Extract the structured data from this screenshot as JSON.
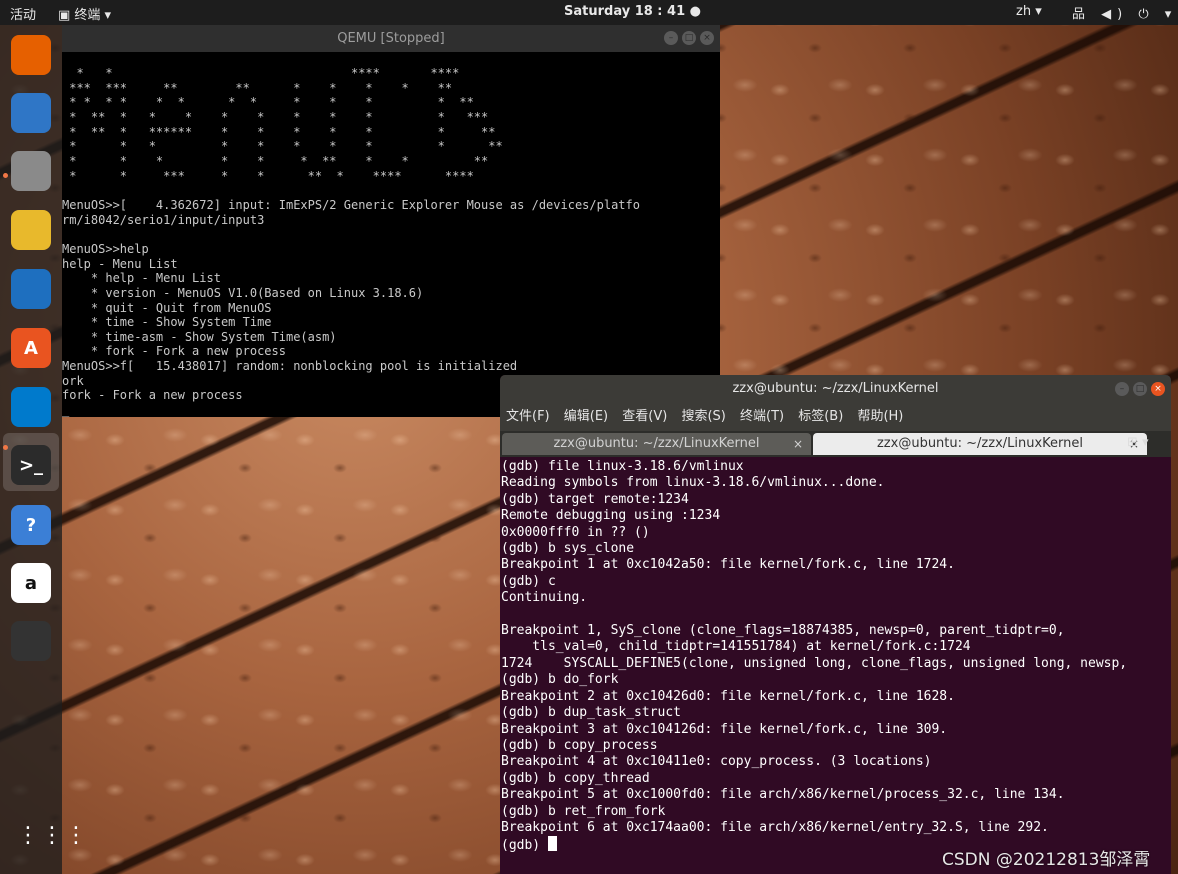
{
  "topbar": {
    "activities": "活动",
    "app_menu": "终端 ▾",
    "clock": "Saturday 18 : 41 ●",
    "lang": "zh ▾",
    "system_icons": "品 ◀) ⏻ ▾"
  },
  "dock": [
    {
      "name": "firefox-icon",
      "glyph": "",
      "color": "#e66000"
    },
    {
      "name": "thunderbird-icon",
      "glyph": "",
      "color": "#2f76c6"
    },
    {
      "name": "files-icon",
      "glyph": "",
      "color": "#8a8a8a"
    },
    {
      "name": "rhythmbox-icon",
      "glyph": "",
      "color": "#e8b92c"
    },
    {
      "name": "writer-icon",
      "glyph": "",
      "color": "#1e6fbf"
    },
    {
      "name": "software-icon",
      "glyph": "A",
      "color": "#e95420"
    },
    {
      "name": "vscode-icon",
      "glyph": "",
      "color": "#007acc"
    },
    {
      "name": "terminal-icon",
      "glyph": ">_",
      "color": "#2b2b2b"
    },
    {
      "name": "help-icon",
      "glyph": "?",
      "color": "#3b7fd6"
    },
    {
      "name": "amazon-icon",
      "glyph": "a",
      "color": "#ffffff"
    },
    {
      "name": "parrot-icon",
      "glyph": "",
      "color": "#333333"
    }
  ],
  "qemu": {
    "title": "QEMU [Stopped]",
    "lines": [
      "  *   *                                 ****       ****",
      " ***  ***     **        **      *    *    *    *    **",
      " * *  * *    *  *      *  *     *    *    *         *  **",
      " *  **  *   *    *    *    *    *    *    *         *   ***",
      " *  **  *   ******    *    *    *    *    *         *     **",
      " *      *   *         *    *    *    *    *         *      **",
      " *      *    *        *    *     *  **    *    *         **",
      " *      *     ***     *    *      **  *    ****      ****",
      "",
      "MenuOS>>[    4.362672] input: ImExPS/2 Generic Explorer Mouse as /devices/platfo",
      "rm/i8042/serio1/input/input3",
      "",
      "MenuOS>>help",
      "help - Menu List",
      "    * help - Menu List",
      "    * version - MenuOS V1.0(Based on Linux 3.18.6)",
      "    * quit - Quit from MenuOS",
      "    * time - Show System Time",
      "    * time-asm - Show System Time(asm)",
      "    * fork - Fork a new process",
      "MenuOS>>f[   15.438017] random: nonblocking pool is initialized",
      "ork",
      "fork - Fork a new process",
      "_"
    ]
  },
  "terminal": {
    "title": "zzx@ubuntu: ~/zzx/LinuxKernel",
    "menus": [
      "文件(F)",
      "编辑(E)",
      "查看(V)",
      "搜索(S)",
      "终端(T)",
      "标签(B)",
      "帮助(H)"
    ],
    "tabs": [
      {
        "label": "zzx@ubuntu: ~/zzx/LinuxKernel",
        "close": "×"
      },
      {
        "label": "zzx@ubuntu: ~/zzx/LinuxKernel",
        "close": "×"
      }
    ],
    "tab_add": "⊞ ▾",
    "lines": [
      "(gdb) file linux-3.18.6/vmlinux",
      "Reading symbols from linux-3.18.6/vmlinux...done.",
      "(gdb) target remote:1234",
      "Remote debugging using :1234",
      "0x0000fff0 in ?? ()",
      "(gdb) b sys_clone",
      "Breakpoint 1 at 0xc1042a50: file kernel/fork.c, line 1724.",
      "(gdb) c",
      "Continuing.",
      "",
      "Breakpoint 1, SyS_clone (clone_flags=18874385, newsp=0, parent_tidptr=0,",
      "    tls_val=0, child_tidptr=141551784) at kernel/fork.c:1724",
      "1724    SYSCALL_DEFINE5(clone, unsigned long, clone_flags, unsigned long, newsp,",
      "(gdb) b do_fork",
      "Breakpoint 2 at 0xc10426d0: file kernel/fork.c, line 1628.",
      "(gdb) b dup_task_struct",
      "Breakpoint 3 at 0xc104126d: file kernel/fork.c, line 309.",
      "(gdb) b copy_process",
      "Breakpoint 4 at 0xc10411e0: copy_process. (3 locations)",
      "(gdb) b copy_thread",
      "Breakpoint 5 at 0xc1000fd0: file arch/x86/kernel/process_32.c, line 134.",
      "(gdb) b ret_from_fork",
      "Breakpoint 6 at 0xc174aa00: file arch/x86/kernel/entry_32.S, line 292."
    ],
    "prompt": "(gdb) "
  },
  "watermark": "CSDN @20212813邹泽霄"
}
